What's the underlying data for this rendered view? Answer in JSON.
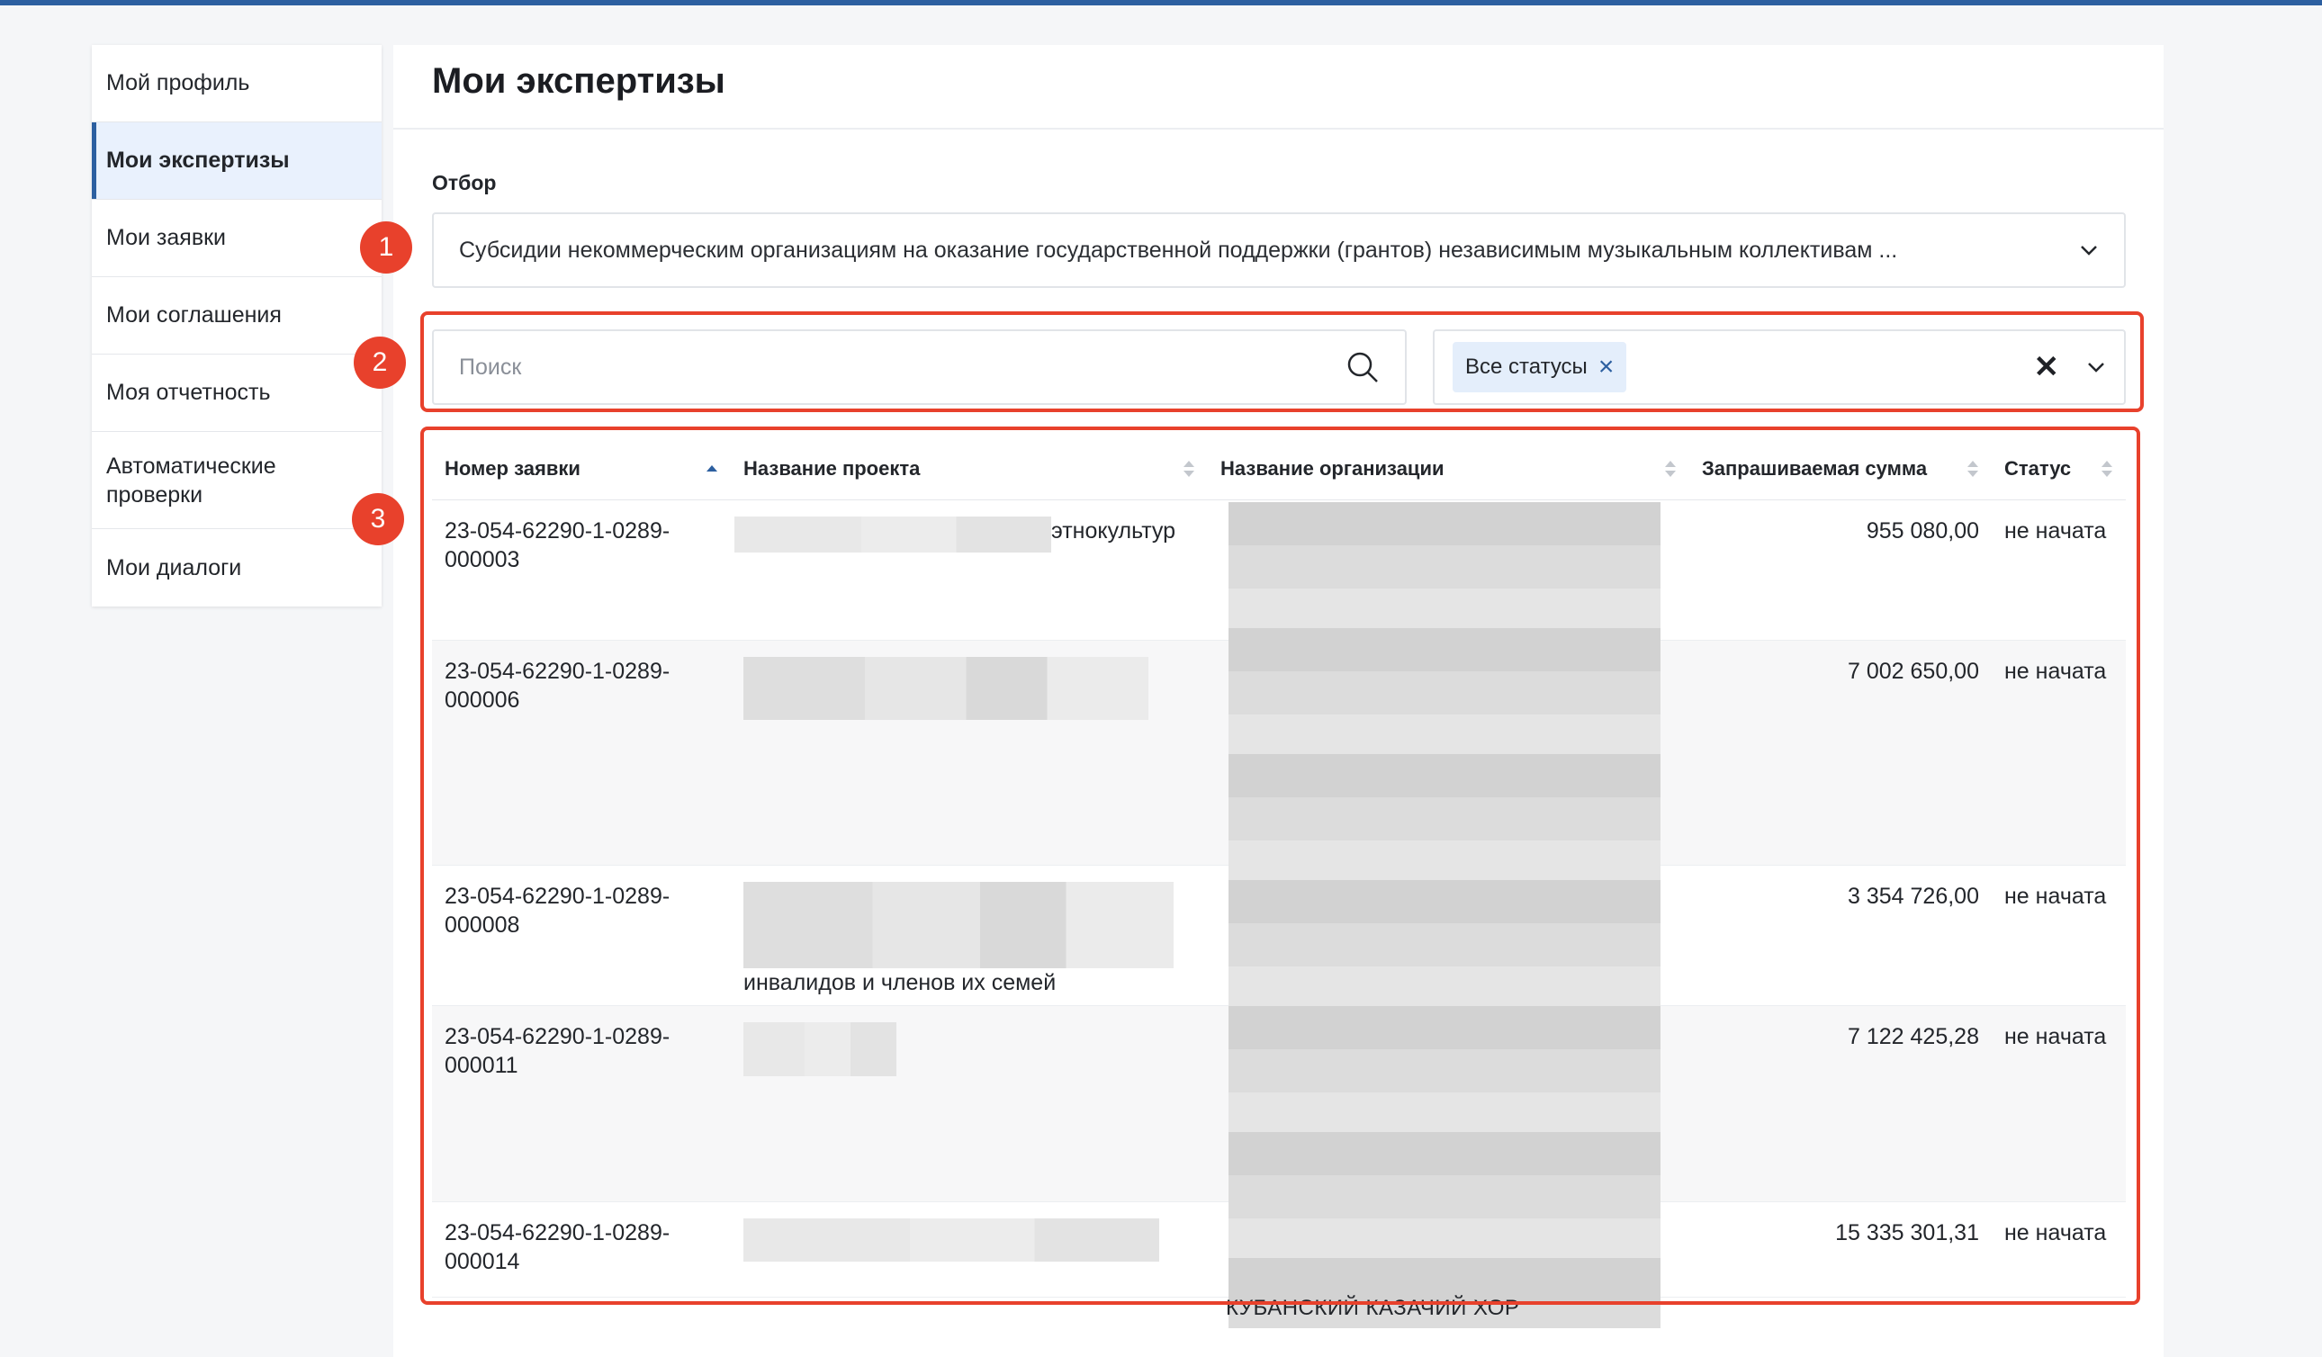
{
  "sidebar": {
    "items": [
      {
        "label": "Мой профиль"
      },
      {
        "label": "Мои экспертизы",
        "active": true
      },
      {
        "label": "Мои заявки"
      },
      {
        "label": "Мои соглашения"
      },
      {
        "label": "Моя отчетность"
      },
      {
        "label": "Автоматические проверки"
      },
      {
        "label": "Мои диалоги"
      }
    ]
  },
  "markers": [
    "1",
    "2",
    "3"
  ],
  "page": {
    "title": "Мои экспертизы"
  },
  "filter": {
    "label": "Отбор",
    "selected": "Субсидии некоммерческим организациям на оказание государственной поддержки (грантов) независимым музыкальным коллективам ..."
  },
  "search": {
    "placeholder": "Поиск"
  },
  "status_filter": {
    "chip": "Все статусы"
  },
  "table": {
    "columns": [
      "Номер заявки",
      "Название проекта",
      "Название организации",
      "Запрашиваемая сумма",
      "Статус"
    ],
    "rows": [
      {
        "number": "23-054-62290-1-0289-000003",
        "project_visible": "этнокультур",
        "amount": "955 080,00",
        "status": "не начата"
      },
      {
        "number": "23-054-62290-1-0289-000006",
        "project_visible": "",
        "amount": "7 002 650,00",
        "status": "не начата"
      },
      {
        "number": "23-054-62290-1-0289-000008",
        "project_visible": "инвалидов и членов их семей",
        "amount": "3 354 726,00",
        "status": "не начата"
      },
      {
        "number": "23-054-62290-1-0289-000011",
        "project_visible": "",
        "amount": "7 122 425,28",
        "status": "не начата"
      },
      {
        "number": "23-054-62290-1-0289-000014",
        "project_visible": "",
        "amount": "15 335 301,31",
        "status": "не начата"
      }
    ],
    "org_caption": "КУБАНСКИЙ КАЗАЧИЙ ХОР"
  },
  "colors": {
    "accent": "#2c5fa0",
    "annotation": "#e8412c",
    "chip_bg": "#e4eefb"
  }
}
